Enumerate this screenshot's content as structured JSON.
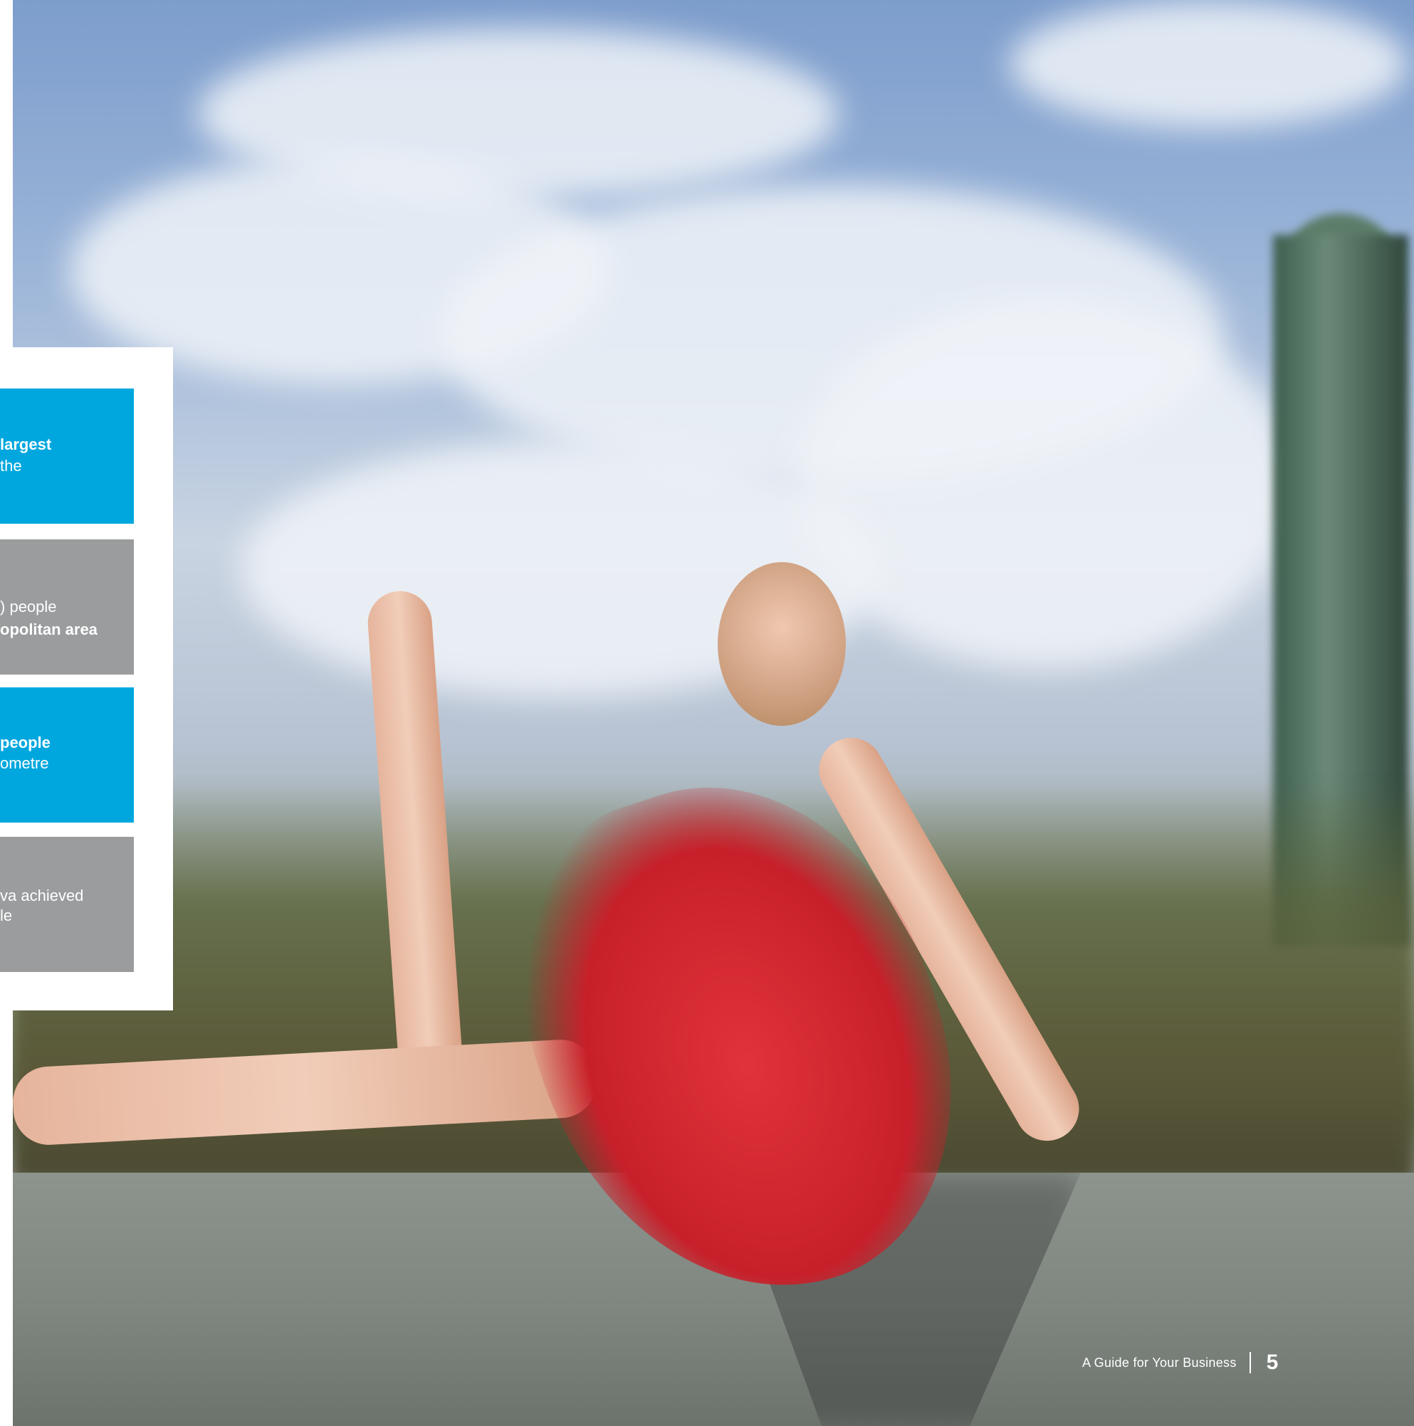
{
  "stats": [
    {
      "line1_bold": "largest",
      "line1_regular": "",
      "line2": "the"
    },
    {
      "line1_bold": "",
      "line1_regular": "people",
      "line2": "opolitan area"
    },
    {
      "line1_bold": "people",
      "line1_regular": "",
      "line2": "ometre"
    },
    {
      "line1_bold": "",
      "line1_regular": "va achieved",
      "line2": "le"
    }
  ],
  "footer": {
    "guide_text": "A Guide for Your Business",
    "page_number": "5"
  },
  "colors": {
    "accent_blue": "#00a7de",
    "panel_grey": "#9a9c9d"
  }
}
